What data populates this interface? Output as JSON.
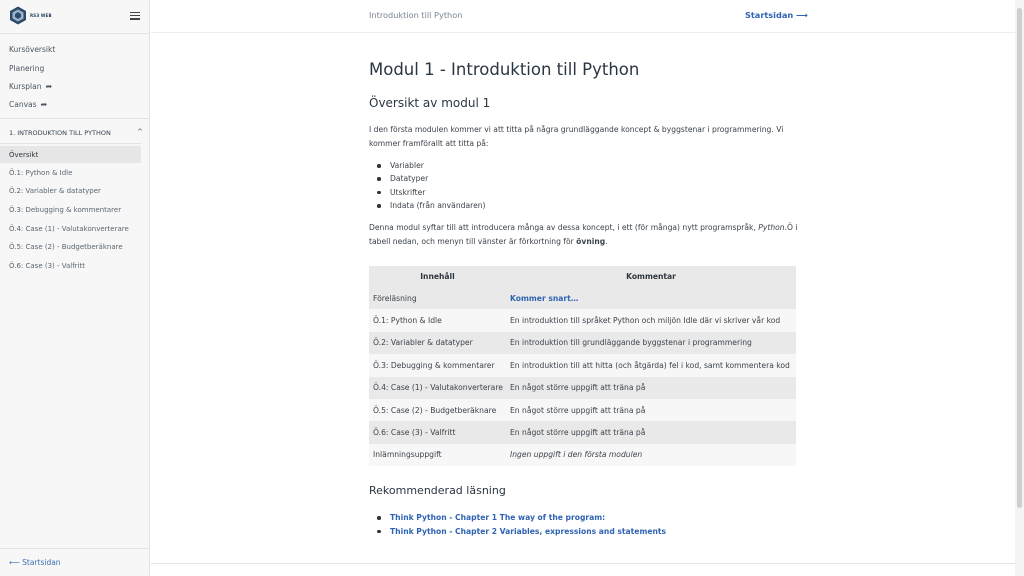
{
  "sidebar": {
    "logo_text": "RS3 WEB",
    "links": [
      {
        "label": "Kursöversikt"
      },
      {
        "label": "Planering"
      },
      {
        "label": "Kursplan",
        "ext": "➦"
      },
      {
        "label": "Canvas",
        "ext": "➦"
      }
    ],
    "section": {
      "label": "1. INTRODUKTION TILL PYTHON",
      "chevron": "^"
    },
    "sub_items": [
      {
        "label": "Översikt",
        "active": true
      },
      {
        "label": "Ö.1: Python & Idle"
      },
      {
        "label": "Ö.2: Variabler & datatyper"
      },
      {
        "label": "Ö.3: Debugging & kommentarer"
      },
      {
        "label": "Ö.4: Case (1) - Valutakonverterare"
      },
      {
        "label": "Ö.5: Case (2) - Budgetberäknare"
      },
      {
        "label": "Ö.6: Case (3) - Valfritt"
      }
    ],
    "footer_link": "⟵ Startsidan"
  },
  "header": {
    "title": "Introduktion till Python",
    "home_link": "Startsidan ⟶"
  },
  "main": {
    "title": "Modul 1 - Introduktion till Python",
    "overview_heading": "Översikt av modul 1",
    "intro_paragraph": "I den första modulen kommer vi att titta på några grundläggande koncept & byggstenar i programmering. Vi kommer framförallt att titta på:",
    "topics": [
      "Variabler",
      "Datatyper",
      "Utskrifter",
      "Indata (från användaren)"
    ],
    "para2_start": "Denna modul syftar till att introducera många av dessa koncept, i ett (för många) nytt programspråk, ",
    "para2_em": "Python.",
    "para2_mid": "Ö i tabell nedan, och menyn till vänster är förkortning för ",
    "para2_bold": "övning",
    "para2_end": ".",
    "table": {
      "headers": [
        "Innehåll",
        "Kommentar"
      ],
      "rows": [
        {
          "c1": "Föreläsning",
          "c2": "Kommer snart…",
          "style": "link"
        },
        {
          "c1": "Ö.1: Python & Idle",
          "c2": "En introduktion till språket Python och miljön Idle där vi skriver vår kod",
          "style": ""
        },
        {
          "c1": "Ö.2: Variabler & datatyper",
          "c2": "En introduktion till grundläggande byggstenar i programmering",
          "style": ""
        },
        {
          "c1": "Ö.3: Debugging & kommentarer",
          "c2": "En introduktion till att hitta (och åtgärda) fel i kod, samt kommentera kod",
          "style": ""
        },
        {
          "c1": "Ö.4: Case (1) - Valutakonverterare",
          "c2": "En något större uppgift att träna på",
          "style": ""
        },
        {
          "c1": "Ö.5: Case (2) - Budgetberäknare",
          "c2": "En något större uppgift att träna på",
          "style": ""
        },
        {
          "c1": "Ö.6: Case (3) - Valfritt",
          "c2": "En något större uppgift att träna på",
          "style": ""
        },
        {
          "c1": "Inlämningsuppgift",
          "c2": "Ingen uppgift i den första modulen",
          "style": "ital"
        }
      ]
    },
    "reading_heading": "Rekommenderad läsning",
    "reading_links": [
      "Think Python - Chapter 1 The way of the program:",
      "Think Python - Chapter 2 Variables, expressions and statements"
    ]
  }
}
